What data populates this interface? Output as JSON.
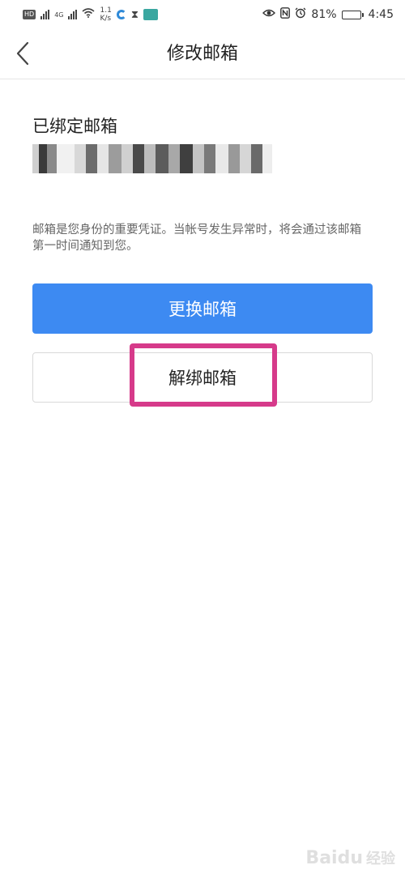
{
  "status_bar": {
    "hd_label": "HD",
    "net_type": "4G",
    "speed_value": "1.1",
    "speed_unit": "K/s",
    "battery_percent_text": "81%",
    "battery_level": 0.81,
    "time": "4:45"
  },
  "header": {
    "title": "修改邮箱",
    "back_icon": "chevron-left-icon"
  },
  "bound_email": {
    "label": "已绑定邮箱",
    "value_masked": true
  },
  "notice": {
    "text": "邮箱是您身份的重要凭证。当帐号发生异常时，将会通过该邮箱第一时间通知到您。"
  },
  "actions": {
    "change_label": "更换邮箱",
    "unbind_label": "解绑邮箱"
  },
  "colors": {
    "primary_button": "#3d8af2",
    "highlight_frame": "#d63a8a",
    "divider": "#e6e6e6"
  },
  "watermark": {
    "brand": "Baidu",
    "sub": "经验"
  }
}
